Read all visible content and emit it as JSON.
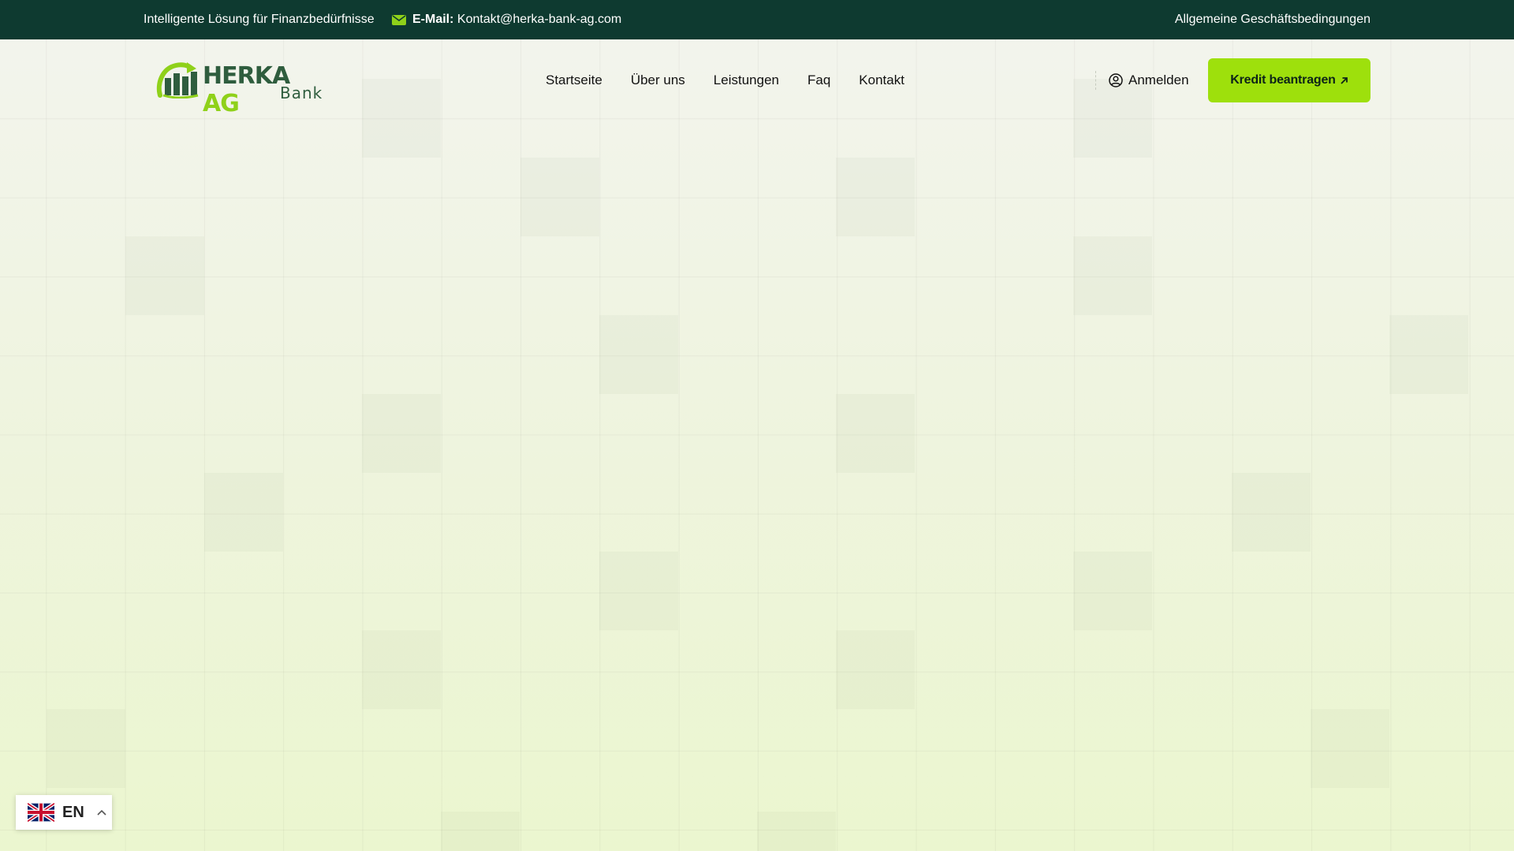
{
  "topbar": {
    "tagline": "Intelligente Lösung für Finanzbedürfnisse",
    "email_label": "E-Mail:",
    "email_value": "Kontakt@herka-bank-ag.com",
    "terms_link": "Allgemeine Geschäftsbedingungen"
  },
  "logo": {
    "brand_main": "HERKA",
    "brand_accent": "AG",
    "brand_sub": "Bank"
  },
  "nav": {
    "items": [
      "Startseite",
      "Über uns",
      "Leistungen",
      "Faq",
      "Kontakt"
    ]
  },
  "header": {
    "login_label": "Anmelden",
    "cta_label": "Kredit beantragen"
  },
  "language": {
    "code": "EN",
    "flag": "uk-flag-icon"
  },
  "colors": {
    "topbar_bg": "#0e3a30",
    "accent": "#9ee00c",
    "brand_dark": "#2f5d3e",
    "brand_light": "#8fd11a"
  },
  "icons": {
    "email": "mail-icon",
    "login": "user-circle-icon",
    "cta": "arrow-up-right-icon",
    "language_toggle": "chevron-up-icon"
  }
}
